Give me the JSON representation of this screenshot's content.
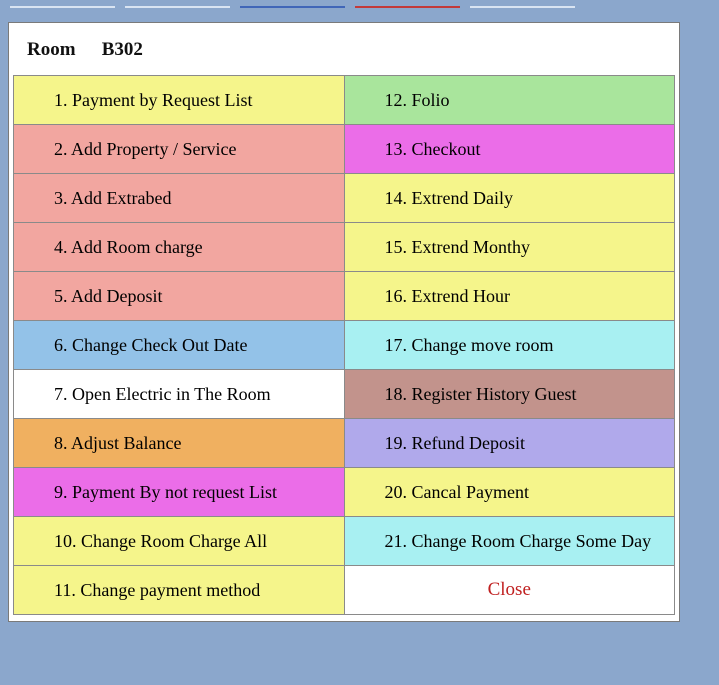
{
  "header": {
    "room_label": "Room",
    "room_number": "B302"
  },
  "menu": {
    "rows": [
      {
        "left": "1.  Payment by Request List",
        "right": "12. Folio"
      },
      {
        "left": "2.  Add Property / Service",
        "right": "13. Checkout"
      },
      {
        "left": "3.  Add Extrabed",
        "right": "14.  Extrend Daily"
      },
      {
        "left": "4.  Add Room charge",
        "right": "15.  Extrend Monthy"
      },
      {
        "left": "5.  Add Deposit",
        "right": "16.  Extrend Hour"
      },
      {
        "left": "6.  Change Check Out Date",
        "right": "17. Change move room"
      },
      {
        "left": "7.  Open Electric in The Room",
        "right": "18. Register History Guest"
      },
      {
        "left": "8.  Adjust Balance",
        "right": "19.  Refund Deposit"
      },
      {
        "left": "9.   Payment By not request List",
        "right": "20. Cancal Payment"
      },
      {
        "left": "10.  Change Room Charge All",
        "right": "21. Change Room Charge Some Day"
      },
      {
        "left": "11.  Change payment method",
        "right": "Close"
      }
    ]
  }
}
